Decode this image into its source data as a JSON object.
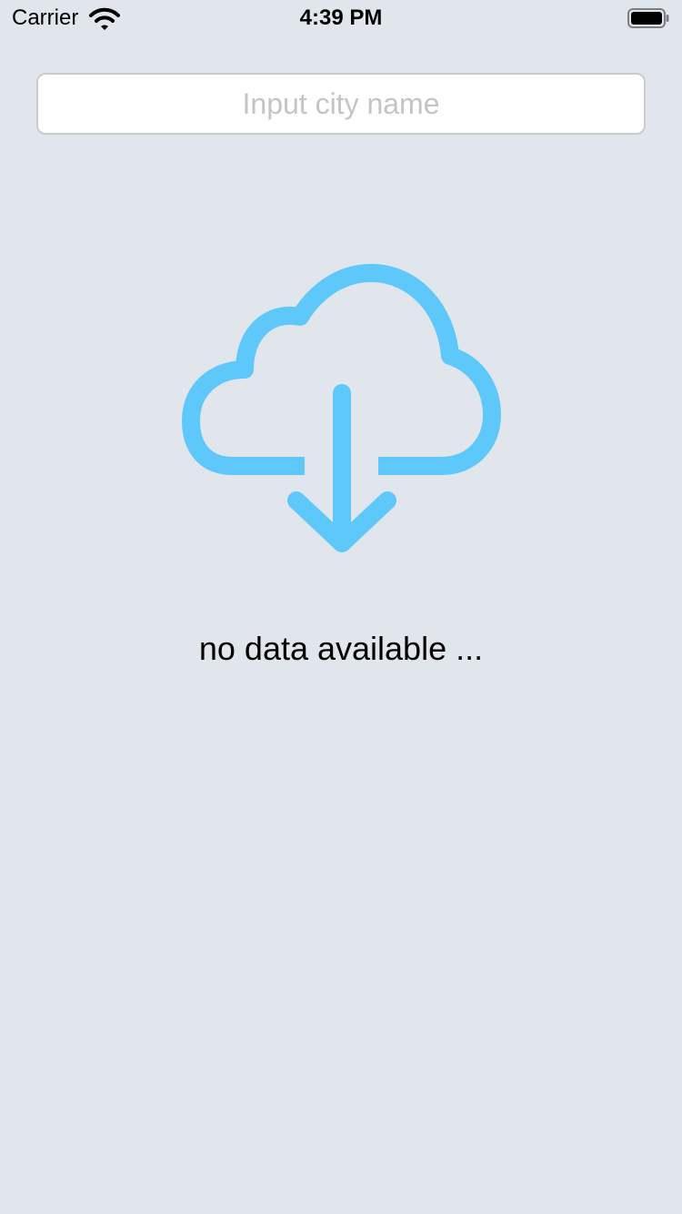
{
  "status_bar": {
    "carrier": "Carrier",
    "time": "4:39 PM",
    "icons": [
      "wifi-icon",
      "battery-icon"
    ]
  },
  "search": {
    "placeholder": "Input city name",
    "value": ""
  },
  "empty_state": {
    "icon": "cloud-download-icon",
    "message": "no data available ..."
  },
  "colors": {
    "background": "#e1e6ed",
    "accent": "#5fc8fb",
    "placeholder": "#c4c4c6"
  }
}
